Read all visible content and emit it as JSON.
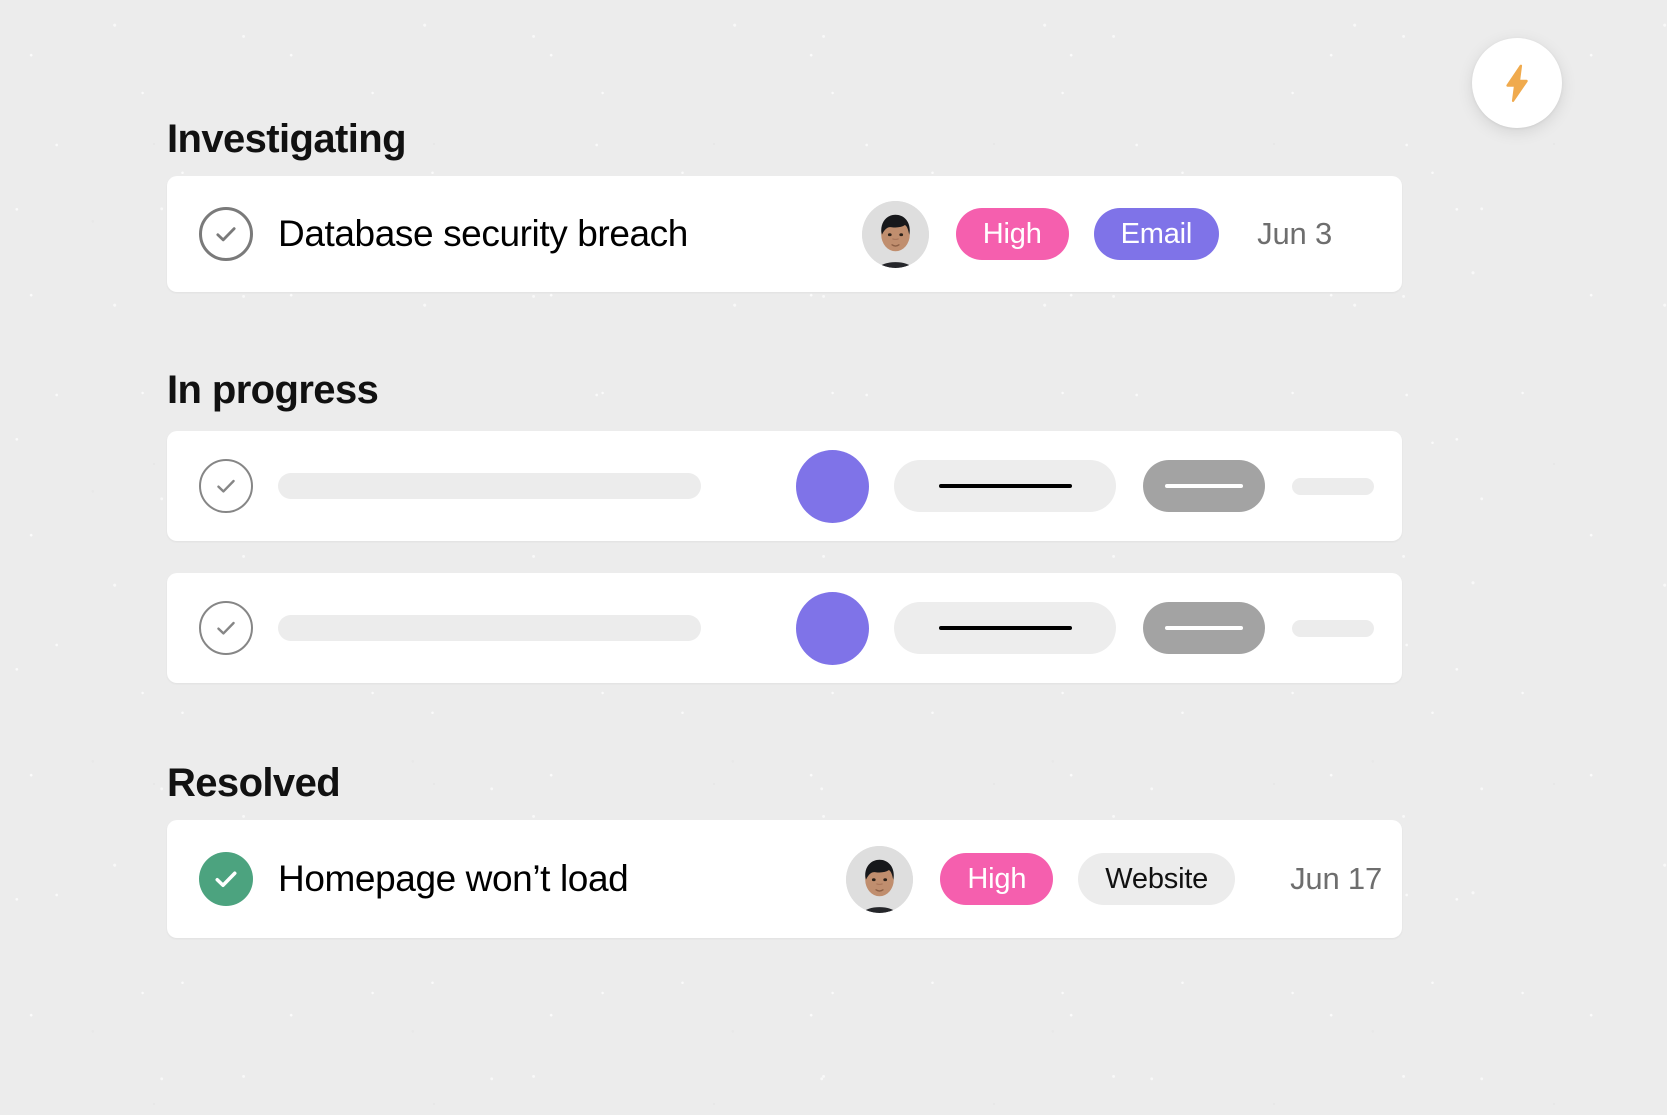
{
  "page": {
    "background_color": "#ececec",
    "card_color": "#ffffff"
  },
  "fab": {
    "icon": "lightning-bolt-icon",
    "icon_color": "#f0aa4d",
    "background": "#ffffff"
  },
  "sections": [
    {
      "id": "investigating",
      "title": "Investigating",
      "rows": [
        {
          "type": "content",
          "status_icon": "check-circle-outline-icon",
          "status_icon_color": "#7a7a7a",
          "title": "Database security breach",
          "avatar": "user-avatar",
          "badges": [
            {
              "label": "High",
              "style": "pink",
              "color": "#f55fae"
            },
            {
              "label": "Email",
              "style": "purple",
              "color": "#7f73e8"
            }
          ],
          "date": "Jun 3"
        }
      ]
    },
    {
      "id": "in-progress",
      "title": "In progress",
      "rows": [
        {
          "type": "skeleton",
          "status_icon": "check-circle-outline-icon",
          "status_icon_color": "#868686",
          "avatar_color": "#7f73e8"
        },
        {
          "type": "skeleton",
          "status_icon": "check-circle-outline-icon",
          "status_icon_color": "#868686",
          "avatar_color": "#7f73e8"
        }
      ]
    },
    {
      "id": "resolved",
      "title": "Resolved",
      "rows": [
        {
          "type": "content",
          "status_icon": "check-circle-filled-icon",
          "status_icon_color": "#4ca37f",
          "title": "Homepage won’t load",
          "avatar": "user-avatar",
          "badges": [
            {
              "label": "High",
              "style": "pink",
              "color": "#f55fae"
            },
            {
              "label": "Website",
              "style": "grey",
              "color": "#ececec"
            }
          ],
          "date": "Jun 17"
        }
      ]
    }
  ]
}
